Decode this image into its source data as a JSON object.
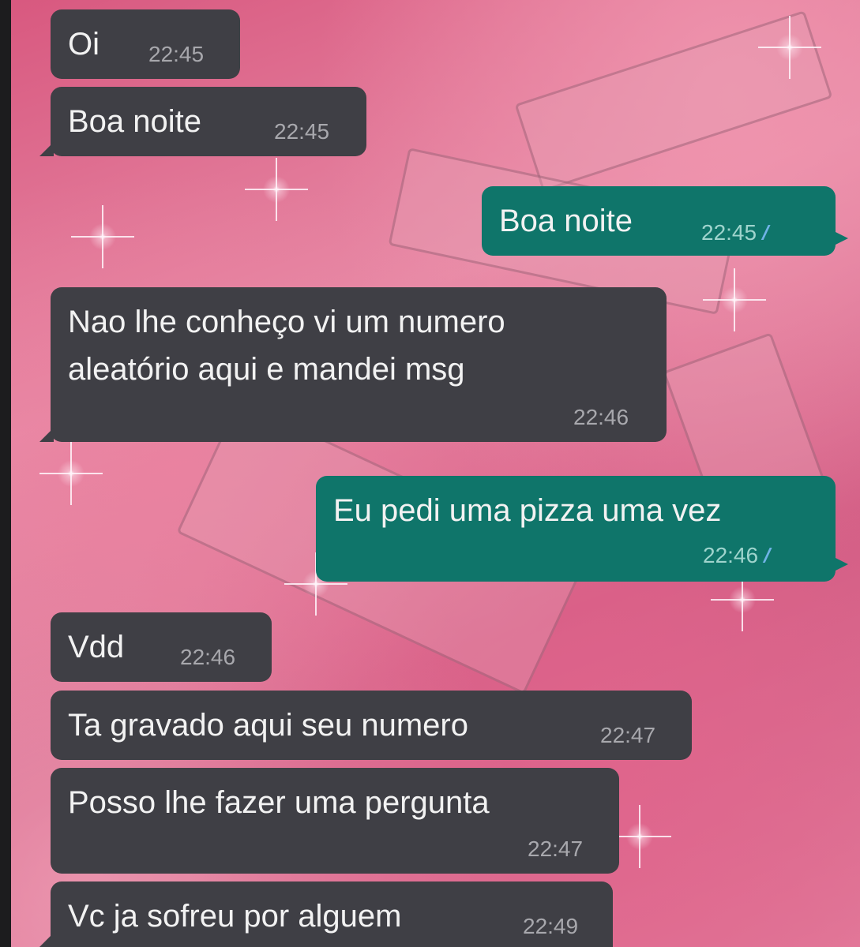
{
  "chat": {
    "messages": [
      {
        "text": "Oi",
        "time": "22:45"
      },
      {
        "text": "Boa noite",
        "time": "22:45"
      },
      {
        "text": "Boa noite",
        "time": "22:45",
        "status": "double-check-icon"
      },
      {
        "text": "Nao lhe conheço vi um numero\naleatório aqui e mandei msg",
        "time": "22:46"
      },
      {
        "text": "Eu pedi uma pizza uma vez",
        "time": "22:46",
        "status": "double-check-icon"
      },
      {
        "text": "Vdd",
        "time": "22:46"
      },
      {
        "text": "Ta gravado aqui seu numero",
        "time": "22:47"
      },
      {
        "text": "Posso lhe fazer uma pergunta",
        "time": "22:47"
      },
      {
        "text": "Vc ja sofreu por alguem",
        "time": "22:49"
      }
    ],
    "colors": {
      "incoming_bubble": "#3f3f45",
      "outgoing_bubble": "#0f756a",
      "read_ticks": "#6fb3e6",
      "wallpaper": "#d8587f"
    }
  }
}
